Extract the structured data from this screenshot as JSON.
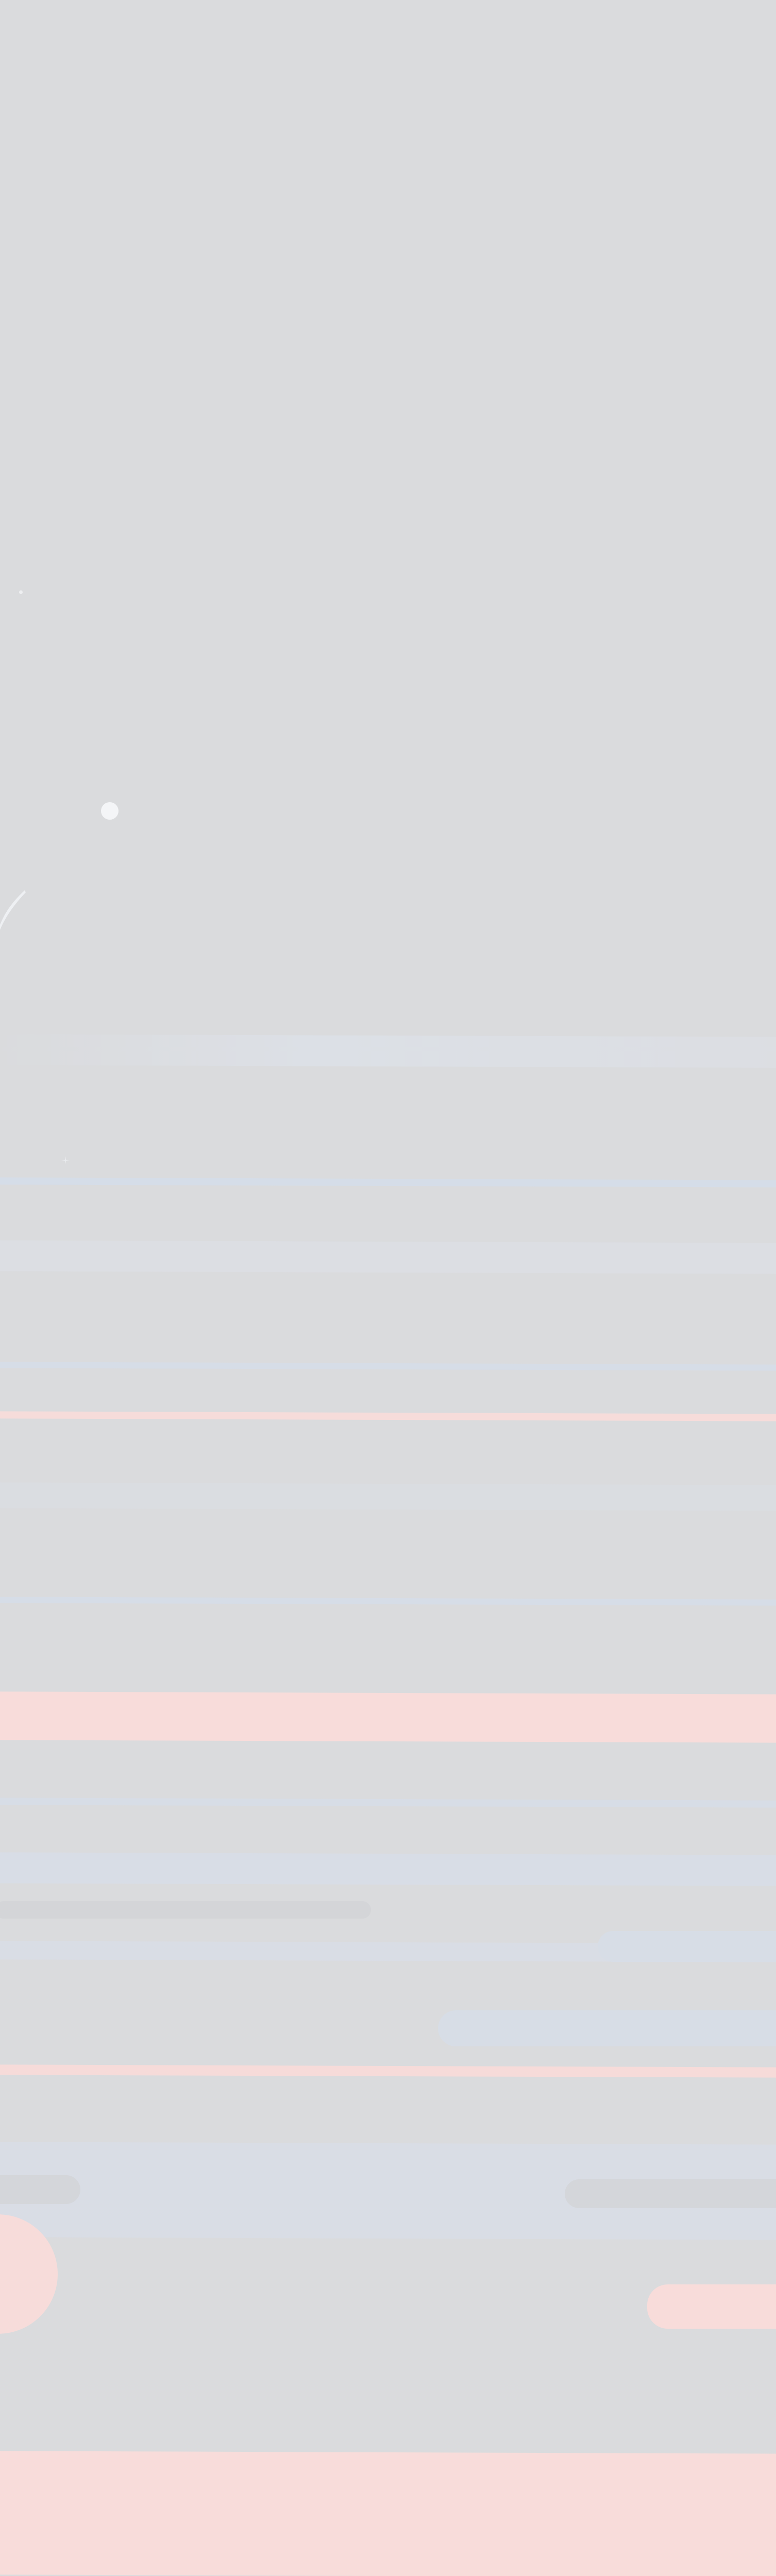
{
  "page": {
    "background_color": "#dadbdd"
  },
  "palette": {
    "light_blue": "#d7dde6",
    "pale_blue": "#dde1e8",
    "soft_pink": "#f8dcda",
    "pale_pink": "#f5dddc",
    "muted_gray": "#d4d5d8",
    "white": "#f2f3f5"
  },
  "decor": {
    "sparkle_icon": "sparkle",
    "streak_icon": "light-streak"
  }
}
